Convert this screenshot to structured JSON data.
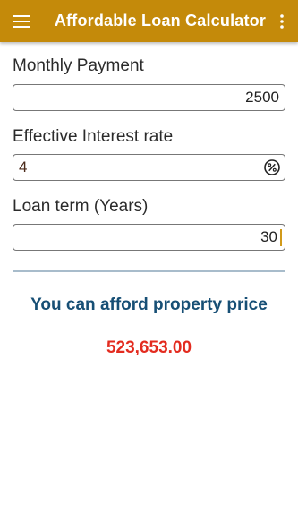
{
  "appbar": {
    "title": "Affordable Loan Calculator",
    "menu_icon": "hamburger-menu-icon",
    "more_icon": "more-vert-icon",
    "background_color": "#c48a0a"
  },
  "form": {
    "monthly_payment": {
      "label": "Monthly Payment",
      "value": "2500"
    },
    "interest_rate": {
      "label": "Effective Interest rate",
      "value": "4",
      "icon": "percent-icon"
    },
    "loan_term": {
      "label": "Loan term (Years)",
      "value": "30"
    }
  },
  "result": {
    "label": "You can afford property price",
    "value": "523,653.00",
    "label_color": "#174f75",
    "value_color": "#e32b1f"
  }
}
